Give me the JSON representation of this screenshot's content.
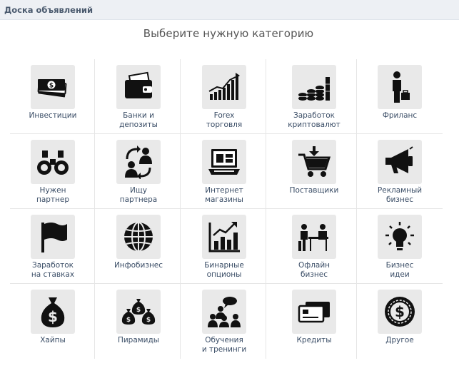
{
  "header": {
    "title": "Доска объявлений"
  },
  "subtitle": "Выберите нужную категорию",
  "categories": [
    {
      "label": "Инвестиции",
      "icon": "money-stack-icon"
    },
    {
      "label": "Банки и\nдепозиты",
      "icon": "wallet-icon"
    },
    {
      "label": "Forex\nторговля",
      "icon": "rising-bars-chart-icon"
    },
    {
      "label": "Заработок\nкриптовалют",
      "icon": "coin-stacks-icon"
    },
    {
      "label": "Фриланс",
      "icon": "businessman-icon"
    },
    {
      "label": "Нужен\nпартнер",
      "icon": "binoculars-icon"
    },
    {
      "label": "Ищу\nпартнера",
      "icon": "people-exchange-icon"
    },
    {
      "label": "Интернет\nмагазины",
      "icon": "laptop-shop-icon"
    },
    {
      "label": "Поставщики",
      "icon": "shopping-cart-icon"
    },
    {
      "label": "Рекламный\nбизнес",
      "icon": "megaphone-icon"
    },
    {
      "label": "Заработок\nна ставках",
      "icon": "flag-icon"
    },
    {
      "label": "Инфобизнес",
      "icon": "globe-icon"
    },
    {
      "label": "Бинарные\nопционы",
      "icon": "growth-chart-icon"
    },
    {
      "label": "Офлайн\nбизнес",
      "icon": "office-meeting-icon"
    },
    {
      "label": "Бизнес\nидеи",
      "icon": "lightbulb-icon"
    },
    {
      "label": "Хайпы",
      "icon": "money-bag-icon"
    },
    {
      "label": "Пирамиды",
      "icon": "money-bags-pyramid-icon"
    },
    {
      "label": "Обучения\nи тренинги",
      "icon": "training-audience-icon"
    },
    {
      "label": "Кредиты",
      "icon": "credit-cards-icon"
    },
    {
      "label": "Другое",
      "icon": "dollar-coin-icon"
    }
  ]
}
